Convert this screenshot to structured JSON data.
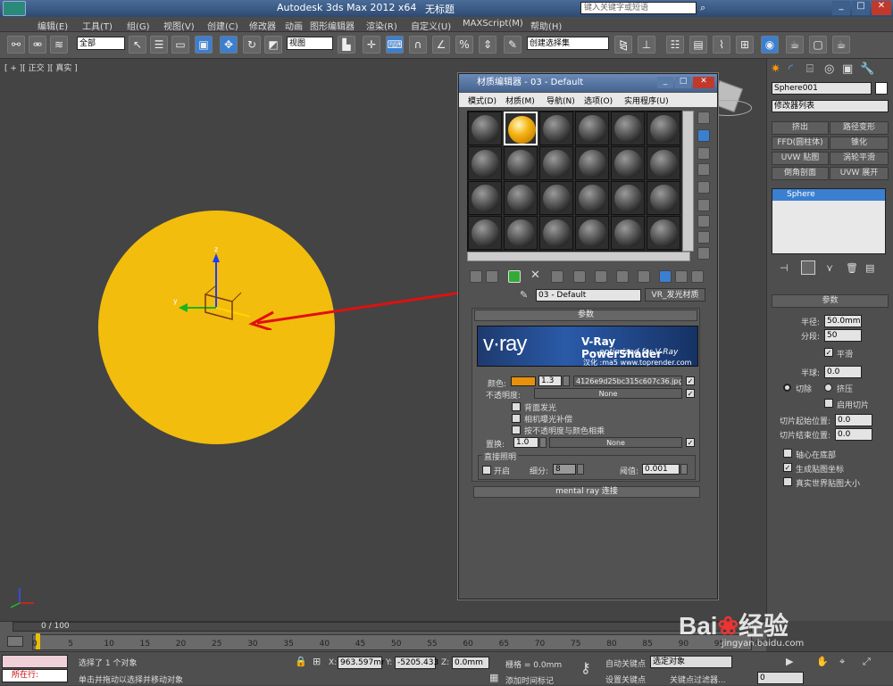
{
  "title": {
    "app": "Autodesk 3ds Max  2012 x64",
    "doc": "无标题",
    "search_placeholder": "键入关键字或短语"
  },
  "menu": [
    "编辑(E)",
    "工具(T)",
    "组(G)",
    "视图(V)",
    "创建(C)",
    "修改器",
    "动画",
    "图形编辑器",
    "渲染(R)",
    "自定义(U)",
    "MAXScript(M)",
    "帮助(H)"
  ],
  "toolbar": {
    "filter": "全部",
    "view": "视图",
    "selection_set": "创建选择集"
  },
  "viewport": {
    "label": "[ + ][ 正交 ][ 真实 ]",
    "axis_x": "x",
    "axis_y": "y",
    "axis_z": "z"
  },
  "cmd": {
    "object_name": "Sphere001",
    "modifier_list": "修改器列表",
    "buttons": [
      "挤出",
      "路径变形",
      "FFD(圆柱体)",
      "锥化",
      "UVW 贴图",
      "涡轮平滑",
      "倒角剖面",
      "UVW 展开"
    ],
    "stack_item": "Sphere",
    "params_title": "参数",
    "radius_label": "半径:",
    "radius": "50.0mm",
    "segments_label": "分段:",
    "segments": "50",
    "smooth_label": "平滑",
    "hemisphere_label": "半球:",
    "hemisphere": "0.0",
    "chop_label": "切除",
    "squash_label": "挤压",
    "slice_label": "启用切片",
    "slice_from_label": "切片起始位置:",
    "slice_from": "0.0",
    "slice_to_label": "切片结束位置:",
    "slice_to": "0.0",
    "base_pivot_label": "轴心在底部",
    "gen_map_label": "生成贴图坐标",
    "real_world_label": "真实世界贴图大小"
  },
  "matedit": {
    "title": "材质编辑器 - 03 - Default",
    "menu": [
      "模式(D)",
      "材质(M)",
      "导航(N)",
      "选项(O)",
      "实用程序(U)"
    ],
    "material_name": "03 - Default",
    "material_type": "VR_发光材质",
    "params_title": "参数",
    "banner_logo": "v·ray",
    "banner_title": "V-Ray PowerShader",
    "banner_sub": "optimized for V-Ray",
    "banner_credit": "汉化 :ma5 www.toprender.com",
    "color_label": "颜色:",
    "color_value": "1.3",
    "color_map": "4126e9d25bc315c607c36.jpg)",
    "color_swatch": "#e8900c",
    "opacity_label": "不透明度:",
    "opacity_map": "None",
    "backside_label": "背面发光",
    "exposure_label": "相机曝光补偿",
    "multiply_label": "按不透明度与颜色相乘",
    "displace_label": "置换:",
    "displace_value": "1.0",
    "displace_map": "None",
    "direct_label": "直接照明",
    "on_label": "开启",
    "subdiv_label": "细分:",
    "subdiv_value": "8",
    "threshold_label": "阈值:",
    "threshold_value": "0.001",
    "mentalray_label": "mental ray 连接"
  },
  "timeline": {
    "frame": "0 / 100",
    "ticks": [
      "0",
      "5",
      "10",
      "15",
      "20",
      "25",
      "30",
      "35",
      "40",
      "45",
      "50",
      "55",
      "60",
      "65",
      "70",
      "75",
      "80",
      "85",
      "90",
      "95",
      "100"
    ]
  },
  "status": {
    "current_label": "所在行:",
    "selected": "选择了 1 个对象",
    "hint": "单击并拖动以选择并移动对象",
    "x": "963.597mr",
    "y": "-5205.433",
    "z": "0.0mm",
    "grid": "栅格 = 0.0mm",
    "add_time_tag": "添加时间标记",
    "auto_key": "自动关键点",
    "selected_obj": "选定对象",
    "set_key": "设置关键点",
    "key_filter": "关键点过滤器...",
    "frame_field": "0"
  }
}
